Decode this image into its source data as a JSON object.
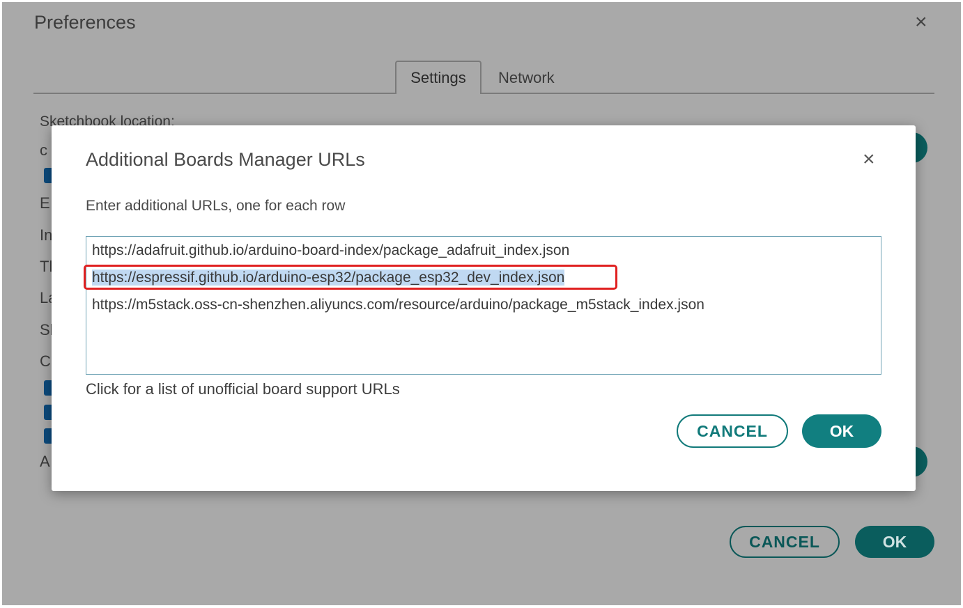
{
  "preferences": {
    "title": "Preferences",
    "close_icon": "×",
    "tabs": [
      {
        "label": "Settings",
        "active": true
      },
      {
        "label": "Network",
        "active": false
      }
    ],
    "sketchbook_label": "Sketchbook location:",
    "partial_letters": [
      "c",
      "E",
      "In",
      "Tl",
      "La",
      "Sl",
      "C",
      "A"
    ],
    "cancel_label": "CANCEL",
    "ok_label": "OK"
  },
  "dialog": {
    "title": "Additional Boards Manager URLs",
    "close_icon": "×",
    "instructions": "Enter additional URLs, one for each row",
    "urls": [
      "https://adafruit.github.io/arduino-board-index/package_adafruit_index.json",
      "https://espressif.github.io/arduino-esp32/package_esp32_dev_index.json",
      "https://m5stack.oss-cn-shenzhen.aliyuncs.com/resource/arduino/package_m5stack_index.json"
    ],
    "selected_url_index": 1,
    "link_text": "Click for a list of unofficial board support URLs",
    "cancel_label": "CANCEL",
    "ok_label": "OK"
  },
  "colors": {
    "accent": "#117f80",
    "overlay": "#a9a9a9",
    "highlight_border": "#e02020",
    "selection": "#c0d9f2"
  }
}
